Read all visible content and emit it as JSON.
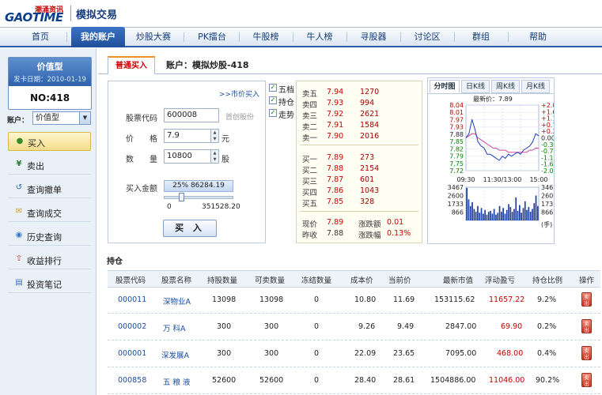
{
  "header": {
    "logo_text": "GAOTIME",
    "logo_sub": "潮涌资讯",
    "app_title": "模拟交易"
  },
  "nav": {
    "items": [
      {
        "label": "首页",
        "active": false
      },
      {
        "label": "我的账户",
        "active": true
      },
      {
        "label": "炒股大赛",
        "active": false
      },
      {
        "label": "PK擂台",
        "active": false
      },
      {
        "label": "牛股榜",
        "active": false
      },
      {
        "label": "牛人榜",
        "active": false
      },
      {
        "label": "寻股器",
        "active": false
      },
      {
        "label": "讨论区",
        "active": false
      },
      {
        "label": "群组",
        "active": false
      },
      {
        "label": "帮助",
        "active": false
      }
    ]
  },
  "sidebar": {
    "card": {
      "type": "价值型",
      "date": "发卡日期：2010-01-19",
      "no": "NO:418"
    },
    "account_label": "账户：",
    "account_value": "价值型",
    "items": [
      {
        "label": "买入",
        "icon": "buy-icon",
        "active": true
      },
      {
        "label": "卖出",
        "icon": "yen-icon",
        "active": false
      },
      {
        "label": "查询撤单",
        "icon": "undo-icon",
        "active": false
      },
      {
        "label": "查询成交",
        "icon": "envelope-icon",
        "active": false
      },
      {
        "label": "历史查询",
        "icon": "history-icon",
        "active": false
      },
      {
        "label": "收益排行",
        "icon": "ranking-icon",
        "active": false
      },
      {
        "label": "投资笔记",
        "icon": "note-icon",
        "active": false
      }
    ]
  },
  "main": {
    "tab": "普通买入",
    "account_title": "账户：模拟炒股-418"
  },
  "order": {
    "market_link": ">>市价买入",
    "code_label": "股票代码",
    "code_value": "600008",
    "code_name": "首创股份",
    "price_label": "价　　格",
    "price_value": "7.9",
    "price_unit": "元",
    "qty_label": "数　　量",
    "qty_value": "10800",
    "qty_unit": "股",
    "amount_label": "买入金额",
    "amount_value": "25% 86284.19",
    "slider_fraction": 0.25,
    "range_min": "0",
    "range_max": "351528.20",
    "buy_label": "买 入"
  },
  "checks": [
    {
      "label": "五档",
      "checked": true
    },
    {
      "label": "持仓",
      "checked": true
    },
    {
      "label": "走势",
      "checked": true
    }
  ],
  "quotes": {
    "sell": [
      {
        "label": "卖五",
        "price": "7.94",
        "vol": "1270"
      },
      {
        "label": "卖四",
        "price": "7.93",
        "vol": "994"
      },
      {
        "label": "卖三",
        "price": "7.92",
        "vol": "2621"
      },
      {
        "label": "卖二",
        "price": "7.91",
        "vol": "1584"
      },
      {
        "label": "卖一",
        "price": "7.90",
        "vol": "2016"
      }
    ],
    "buy": [
      {
        "label": "买一",
        "price": "7.89",
        "vol": "273"
      },
      {
        "label": "买二",
        "price": "7.88",
        "vol": "2154"
      },
      {
        "label": "买三",
        "price": "7.87",
        "vol": "601"
      },
      {
        "label": "买四",
        "price": "7.86",
        "vol": "1043"
      },
      {
        "label": "买五",
        "price": "7.85",
        "vol": "328"
      }
    ],
    "summary": [
      {
        "l1": "现价",
        "v1": "7.89",
        "l2": "涨跌额",
        "v2": "0.01"
      },
      {
        "l1": "昨收",
        "v1": "7.88",
        "l2": "涨跌幅",
        "v2": "0.13%"
      }
    ]
  },
  "chart": {
    "tabs": [
      "分时图",
      "日K线",
      "周K线",
      "月K线"
    ],
    "latest_label": "最新价：7.89",
    "price_ticks_left": [
      "8.04",
      "8.01",
      "7.97",
      "7.93",
      "7.88",
      "7.85",
      "7.82",
      "7.79",
      "7.75",
      "7.72"
    ],
    "pct_ticks_right": [
      "+2.00%",
      "+1.65%",
      "+1.14%",
      "+0.76%",
      "+0.38%",
      "0.00%",
      "-0.38%",
      "-0.76%",
      "-1.14%",
      "-1.65%",
      "-2.00%"
    ],
    "time_labels": [
      "09:30",
      "11:30/13:00",
      "15:00"
    ],
    "vol_ticks": [
      "3467",
      "2600",
      "1733",
      "866"
    ],
    "vol_unit": "(手)",
    "colors": {
      "price_line": "#1f3fbf",
      "avg_line": "#d048a0",
      "volume": "#1f3f9f",
      "up": "#c00000",
      "down": "#008000"
    }
  },
  "chart_data": {
    "type": "line",
    "x_labels": [
      "09:30",
      "11:30/13:00",
      "15:00"
    ],
    "ylim": [
      7.72,
      8.04
    ],
    "series": [
      {
        "values": [
          7.88,
          7.9,
          7.97,
          7.92,
          7.86,
          7.84,
          7.83,
          7.8,
          7.8,
          7.79,
          7.78,
          7.77,
          7.79,
          7.78,
          7.8,
          7.79,
          7.8,
          7.81,
          7.8,
          7.82,
          7.83,
          7.84,
          7.86,
          7.9,
          7.89
        ]
      },
      {
        "values": [
          7.88,
          7.89,
          7.9,
          7.9,
          7.88,
          7.87,
          7.86,
          7.85,
          7.84,
          7.83,
          7.83,
          7.82,
          7.82,
          7.82,
          7.81,
          7.81,
          7.81,
          7.81,
          7.81,
          7.81,
          7.81,
          7.82,
          7.82,
          7.83,
          7.83
        ]
      }
    ],
    "volume": {
      "ylim": [
        0,
        3467
      ],
      "values": [
        3400,
        2200,
        1500,
        1900,
        1200,
        900,
        1500,
        800,
        1300,
        700,
        1100,
        600,
        900,
        1000,
        700,
        1200,
        600,
        800,
        1500,
        900,
        1300,
        700,
        1100,
        1700,
        1400,
        900,
        1200,
        2400,
        1000,
        1600,
        800,
        1300,
        2000,
        1100,
        1400,
        900,
        1200,
        1800,
        2600,
        1500
      ]
    }
  },
  "holdings": {
    "title": "持仓",
    "columns": [
      "股票代码",
      "股票名称",
      "持股数量",
      "可卖数量",
      "冻结数量",
      "成本价",
      "当前价",
      "最新市值",
      "浮动盈亏",
      "持仓比例",
      "操作"
    ],
    "rows": [
      {
        "code": "000011",
        "name": "深物业A",
        "qty": "13098",
        "sellable": "13098",
        "frozen": "0",
        "cost": "10.80",
        "price": "11.69",
        "value": "153115.62",
        "pnl": "11657.22",
        "ratio": "9.2%",
        "op": "卖出"
      },
      {
        "code": "000002",
        "name": "万 科A",
        "qty": "300",
        "sellable": "300",
        "frozen": "0",
        "cost": "9.26",
        "price": "9.49",
        "value": "2847.00",
        "pnl": "69.90",
        "ratio": "0.2%",
        "op": "卖出"
      },
      {
        "code": "000001",
        "name": "深发展A",
        "qty": "300",
        "sellable": "300",
        "frozen": "0",
        "cost": "22.09",
        "price": "23.65",
        "value": "7095.00",
        "pnl": "468.00",
        "ratio": "0.4%",
        "op": "卖出"
      },
      {
        "code": "000858",
        "name": "五 粮 液",
        "qty": "52600",
        "sellable": "52600",
        "frozen": "0",
        "cost": "28.40",
        "price": "28.61",
        "value": "1504886.00",
        "pnl": "11046.00",
        "ratio": "90.2%",
        "op": "卖出"
      }
    ]
  }
}
